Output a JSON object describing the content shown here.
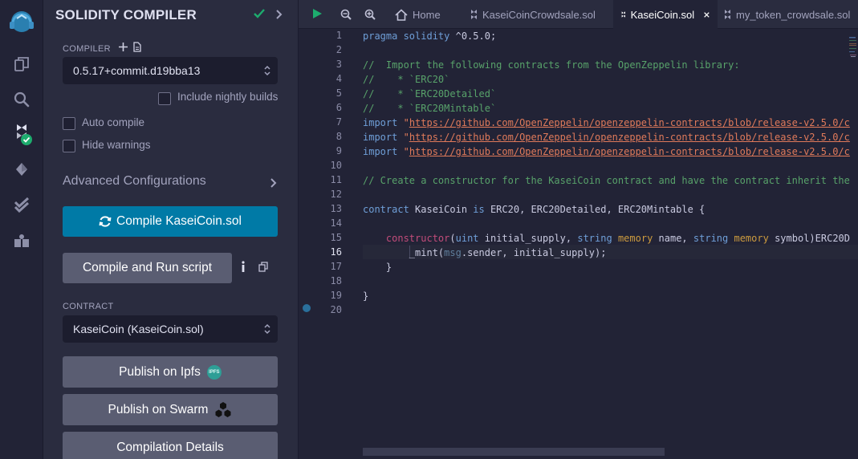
{
  "rail": {
    "icons": [
      "remix-logo",
      "file-explorer-icon",
      "search-icon",
      "solidity-compiler-icon",
      "deploy-run-icon",
      "test-icon",
      "plugin-manager-icon"
    ]
  },
  "panel": {
    "title": "SOLIDITY COMPILER",
    "compiler_label": "COMPILER",
    "compiler_version": "0.5.17+commit.d19bba13",
    "nightly_label": "Include nightly builds",
    "auto_compile_label": "Auto compile",
    "hide_warnings_label": "Hide warnings",
    "advanced_label": "Advanced Configurations",
    "compile_button": "Compile KaseiCoin.sol",
    "run_script_button": "Compile and Run script",
    "contract_label": "CONTRACT",
    "contract_value": "KaseiCoin (KaseiCoin.sol)",
    "publish_ipfs": "Publish on Ipfs",
    "ipfs_badge": "IPFS",
    "publish_swarm": "Publish on Swarm",
    "compilation_details": "Compilation Details"
  },
  "tabs": [
    {
      "label": "Home",
      "icon": "home-icon"
    },
    {
      "label": "KaseiCoinCrowdsale.sol",
      "icon": "solidity-file-icon"
    },
    {
      "label": "KaseiCoin.sol",
      "icon": "solidity-file-icon",
      "active": true
    },
    {
      "label": "my_token_crowdsale.sol",
      "icon": "solidity-file-icon"
    }
  ],
  "editor": {
    "line_numbers": [
      "1",
      "2",
      "3",
      "4",
      "5",
      "6",
      "7",
      "8",
      "9",
      "10",
      "11",
      "12",
      "13",
      "14",
      "15",
      "16",
      "17",
      "18",
      "19",
      "20"
    ],
    "active_line": 16,
    "code": {
      "l1_kw": "pragma solidity",
      "l1_rest": " ^0.5.0;",
      "l3": "//  Import the following contracts from the OpenZeppelin library:",
      "l4": "//    * `ERC20`",
      "l5": "//    * `ERC20Detailed`",
      "l6": "//    * `ERC20Mintable`",
      "import_kw": "import",
      "import_q": " \"",
      "l7_url": "https://github.com/OpenZeppelin/openzeppelin-contracts/blob/release-v2.5.0/c",
      "l8_url": "https://github.com/OpenZeppelin/openzeppelin-contracts/blob/release-v2.5.0/c",
      "l9_url": "https://github.com/OpenZeppelin/openzeppelin-contracts/blob/release-v2.5.0/c",
      "l11": "// Create a constructor for the KaseiCoin contract and have the contract inherit the",
      "l13_kw": "contract",
      "l13_name": " KaseiCoin ",
      "l13_is": "is",
      "l13_rest": " ERC20, ERC20Detailed, ERC20Mintable {",
      "l15_indent": "    ",
      "l15_fn": "constructor",
      "l15_p1": "(",
      "l15_t1": "uint",
      "l15_p2": " initial_supply, ",
      "l15_t2": "string",
      "l15_sp1": " ",
      "l15_m1": "memory",
      "l15_p3": " name, ",
      "l15_t3": "string",
      "l15_sp2": " ",
      "l15_m2": "memory",
      "l15_p4": " symbol)ERC20D",
      "l16_indent": "        ",
      "l16_a": "_mint(",
      "l16_msg": "msg",
      "l16_b": ".sender, initial_supply);",
      "l17": "    }",
      "l19": "}"
    }
  }
}
